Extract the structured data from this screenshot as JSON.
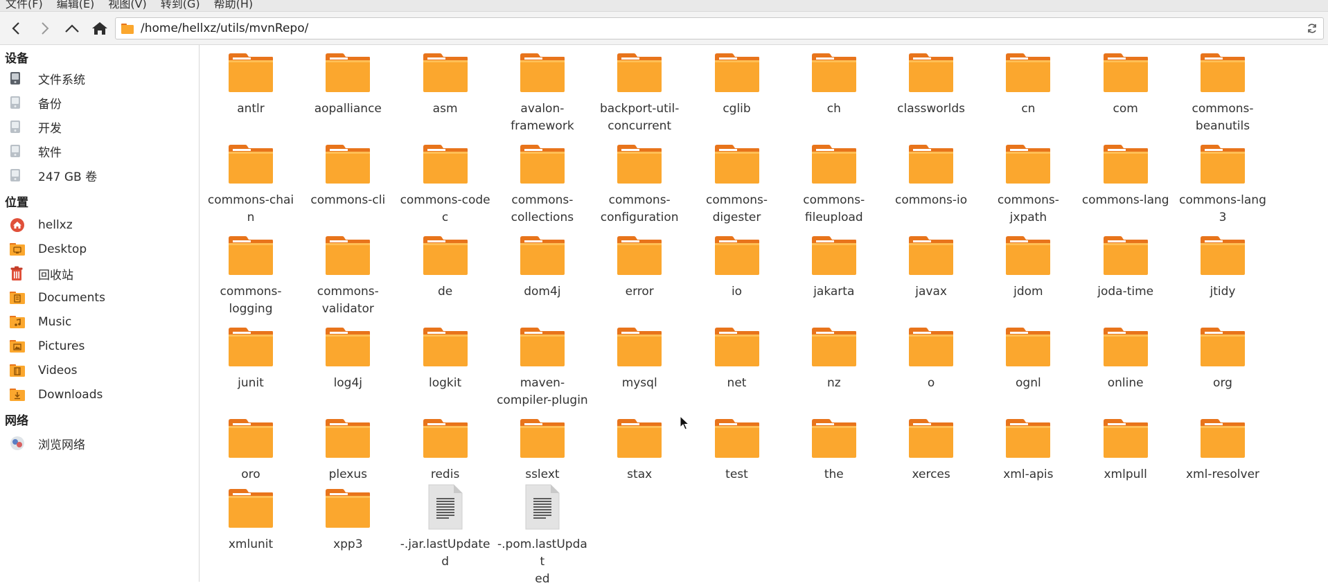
{
  "menubar": {
    "items": [
      "文件(F)",
      "编辑(E)",
      "视图(V)",
      "转到(G)",
      "帮助(H)"
    ]
  },
  "toolbar": {
    "location": "/home/hellxz/utils/mvnRepo/"
  },
  "sidebar": {
    "devices_title": "设备",
    "devices": [
      "文件系统",
      "备份",
      "开发",
      "软件",
      "247 GB 卷"
    ],
    "places_title": "位置",
    "places": [
      {
        "label": "hellxz",
        "icon": "home-icon"
      },
      {
        "label": "Desktop",
        "icon": "desktop-icon"
      },
      {
        "label": "回收站",
        "icon": "trash-icon"
      },
      {
        "label": "Documents",
        "icon": "documents-icon"
      },
      {
        "label": "Music",
        "icon": "music-icon"
      },
      {
        "label": "Pictures",
        "icon": "pictures-icon"
      },
      {
        "label": "Videos",
        "icon": "videos-icon"
      },
      {
        "label": "Downloads",
        "icon": "downloads-icon"
      }
    ],
    "network_title": "网络",
    "network": [
      "浏览网络"
    ]
  },
  "files": [
    {
      "name": "antlr",
      "type": "folder"
    },
    {
      "name": "aopalliance",
      "type": "folder"
    },
    {
      "name": "asm",
      "type": "folder"
    },
    {
      "name": "avalon-\nframework",
      "type": "folder"
    },
    {
      "name": "backport-util-\nconcurrent",
      "type": "folder"
    },
    {
      "name": "cglib",
      "type": "folder"
    },
    {
      "name": "ch",
      "type": "folder"
    },
    {
      "name": "classworlds",
      "type": "folder"
    },
    {
      "name": "cn",
      "type": "folder"
    },
    {
      "name": "com",
      "type": "folder"
    },
    {
      "name": "commons-\nbeanutils",
      "type": "folder"
    },
    {
      "name": "commons-chain",
      "type": "folder"
    },
    {
      "name": "commons-cli",
      "type": "folder"
    },
    {
      "name": "commons-codec",
      "type": "folder"
    },
    {
      "name": "commons-\ncollections",
      "type": "folder"
    },
    {
      "name": "commons-\nconfiguration",
      "type": "folder"
    },
    {
      "name": "commons-\ndigester",
      "type": "folder"
    },
    {
      "name": "commons-\nfileupload",
      "type": "folder"
    },
    {
      "name": "commons-io",
      "type": "folder"
    },
    {
      "name": "commons-\njxpath",
      "type": "folder"
    },
    {
      "name": "commons-lang",
      "type": "folder"
    },
    {
      "name": "commons-lang3",
      "type": "folder"
    },
    {
      "name": "commons-\nlogging",
      "type": "folder"
    },
    {
      "name": "commons-\nvalidator",
      "type": "folder"
    },
    {
      "name": "de",
      "type": "folder"
    },
    {
      "name": "dom4j",
      "type": "folder"
    },
    {
      "name": "error",
      "type": "folder"
    },
    {
      "name": "io",
      "type": "folder"
    },
    {
      "name": "jakarta",
      "type": "folder"
    },
    {
      "name": "javax",
      "type": "folder"
    },
    {
      "name": "jdom",
      "type": "folder"
    },
    {
      "name": "joda-time",
      "type": "folder"
    },
    {
      "name": "jtidy",
      "type": "folder"
    },
    {
      "name": "junit",
      "type": "folder"
    },
    {
      "name": "log4j",
      "type": "folder"
    },
    {
      "name": "logkit",
      "type": "folder"
    },
    {
      "name": "maven-\ncompiler-plugin",
      "type": "folder"
    },
    {
      "name": "mysql",
      "type": "folder"
    },
    {
      "name": "net",
      "type": "folder"
    },
    {
      "name": "nz",
      "type": "folder"
    },
    {
      "name": "o",
      "type": "folder"
    },
    {
      "name": "ognl",
      "type": "folder"
    },
    {
      "name": "online",
      "type": "folder"
    },
    {
      "name": "org",
      "type": "folder"
    },
    {
      "name": "oro",
      "type": "folder"
    },
    {
      "name": "plexus",
      "type": "folder"
    },
    {
      "name": "redis",
      "type": "folder"
    },
    {
      "name": "sslext",
      "type": "folder"
    },
    {
      "name": "stax",
      "type": "folder"
    },
    {
      "name": "test",
      "type": "folder"
    },
    {
      "name": "the",
      "type": "folder"
    },
    {
      "name": "xerces",
      "type": "folder"
    },
    {
      "name": "xml-apis",
      "type": "folder"
    },
    {
      "name": "xmlpull",
      "type": "folder"
    },
    {
      "name": "xml-resolver",
      "type": "folder"
    },
    {
      "name": "xmlunit",
      "type": "folder"
    },
    {
      "name": "xpp3",
      "type": "folder"
    },
    {
      "name": "-.jar.lastUpdate\nd",
      "type": "file"
    },
    {
      "name": "-.pom.lastUpdat\ned",
      "type": "file"
    }
  ],
  "colors": {
    "folder_body": "#fba72e",
    "folder_tab": "#e8741b",
    "accent_red": "#e0503a"
  }
}
